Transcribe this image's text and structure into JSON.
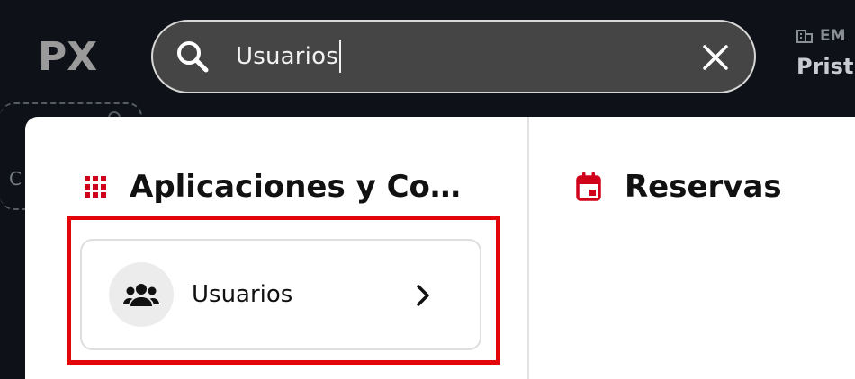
{
  "header": {
    "logo_text": "PX",
    "search": {
      "value": "Usuarios",
      "placeholder": ""
    },
    "company": {
      "label": "EM",
      "name": "Pristi"
    }
  },
  "background_widget": {
    "text": "C"
  },
  "dropdown": {
    "sections": [
      {
        "title": "Aplicaciones y Configuración",
        "icon": "apps-grid-icon",
        "items": [
          {
            "label": "Usuarios",
            "icon": "users-group-icon"
          }
        ]
      },
      {
        "title": "Reservas",
        "icon": "calendar-icon",
        "items": []
      }
    ]
  },
  "colors": {
    "accent_red": "#d0021b",
    "highlight_red": "#e4050a",
    "background": "#0e1117",
    "search_bg": "#454545"
  }
}
